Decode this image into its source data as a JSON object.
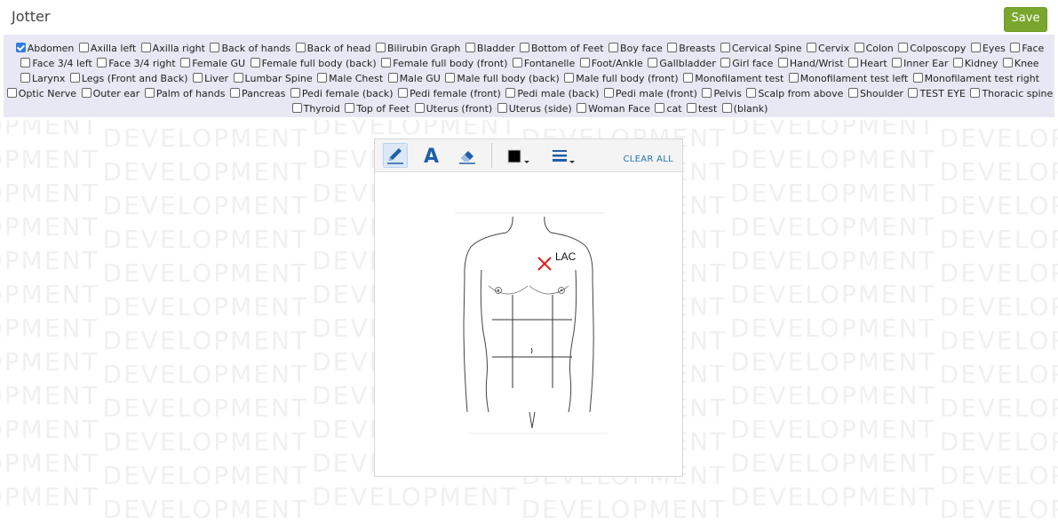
{
  "app": {
    "title": "Jotter"
  },
  "header": {
    "save_label": "Save"
  },
  "watermark": {
    "text": "DEVELOPMENT"
  },
  "filters": {
    "options": [
      {
        "label": "Abdomen",
        "checked": true
      },
      {
        "label": "Axilla left",
        "checked": false
      },
      {
        "label": "Axilla right",
        "checked": false
      },
      {
        "label": "Back of hands",
        "checked": false
      },
      {
        "label": "Back of head",
        "checked": false
      },
      {
        "label": "Bilirubin Graph",
        "checked": false
      },
      {
        "label": "Bladder",
        "checked": false
      },
      {
        "label": "Bottom of Feet",
        "checked": false
      },
      {
        "label": "Boy face",
        "checked": false
      },
      {
        "label": "Breasts",
        "checked": false
      },
      {
        "label": "Cervical Spine",
        "checked": false
      },
      {
        "label": "Cervix",
        "checked": false
      },
      {
        "label": "Colon",
        "checked": false
      },
      {
        "label": "Colposcopy",
        "checked": false
      },
      {
        "label": "Eyes",
        "checked": false
      },
      {
        "label": "Face",
        "checked": false
      },
      {
        "label": "Face 3/4 left",
        "checked": false
      },
      {
        "label": "Face 3/4 right",
        "checked": false
      },
      {
        "label": "Female GU",
        "checked": false
      },
      {
        "label": "Female full body (back)",
        "checked": false
      },
      {
        "label": "Female full body (front)",
        "checked": false
      },
      {
        "label": "Fontanelle",
        "checked": false
      },
      {
        "label": "Foot/Ankle",
        "checked": false
      },
      {
        "label": "Gallbladder",
        "checked": false
      },
      {
        "label": "Girl face",
        "checked": false
      },
      {
        "label": "Hand/Wrist",
        "checked": false
      },
      {
        "label": "Heart",
        "checked": false
      },
      {
        "label": "Inner Ear",
        "checked": false
      },
      {
        "label": "Kidney",
        "checked": false
      },
      {
        "label": "Knee",
        "checked": false
      },
      {
        "label": "Larynx",
        "checked": false
      },
      {
        "label": "Legs (Front and Back)",
        "checked": false
      },
      {
        "label": "Liver",
        "checked": false
      },
      {
        "label": "Lumbar Spine",
        "checked": false
      },
      {
        "label": "Male Chest",
        "checked": false
      },
      {
        "label": "Male GU",
        "checked": false
      },
      {
        "label": "Male full body (back)",
        "checked": false
      },
      {
        "label": "Male full body (front)",
        "checked": false
      },
      {
        "label": "Monofilament test",
        "checked": false
      },
      {
        "label": "Monofilament test left",
        "checked": false
      },
      {
        "label": "Monofilament test right",
        "checked": false
      },
      {
        "label": "Optic Nerve",
        "checked": false
      },
      {
        "label": "Outer ear",
        "checked": false
      },
      {
        "label": "Palm of hands",
        "checked": false
      },
      {
        "label": "Pancreas",
        "checked": false
      },
      {
        "label": "Pedi female (back)",
        "checked": false
      },
      {
        "label": "Pedi female (front)",
        "checked": false
      },
      {
        "label": "Pedi male (back)",
        "checked": false
      },
      {
        "label": "Pedi male (front)",
        "checked": false
      },
      {
        "label": "Pelvis",
        "checked": false
      },
      {
        "label": "Scalp from above",
        "checked": false
      },
      {
        "label": "Shoulder",
        "checked": false
      },
      {
        "label": "TEST EYE",
        "checked": false
      },
      {
        "label": "Thoracic spine",
        "checked": false
      },
      {
        "label": "Thyroid",
        "checked": false
      },
      {
        "label": "Top of Feet",
        "checked": false
      },
      {
        "label": "Uterus (front)",
        "checked": false
      },
      {
        "label": "Uterus (side)",
        "checked": false
      },
      {
        "label": "Woman Face",
        "checked": false
      },
      {
        "label": "cat",
        "checked": false
      },
      {
        "label": "test",
        "checked": false
      },
      {
        "label": "(blank)",
        "checked": false
      }
    ]
  },
  "toolbar": {
    "tools": [
      {
        "name": "pencil-tool",
        "icon": "pencil-icon",
        "active": true
      },
      {
        "name": "text-tool",
        "icon": "text-a-icon",
        "active": false
      },
      {
        "name": "eraser-tool",
        "icon": "eraser-icon",
        "active": false
      }
    ],
    "color_picker": {
      "icon": "color-swatch-icon",
      "selected_color": "#000000"
    },
    "line_width_picker": {
      "icon": "line-width-icon"
    },
    "clear_label": "CLEAR ALL",
    "accent_color": "#1f77b4"
  },
  "canvas": {
    "image": "male-torso-abdomen-diagram",
    "annotations": [
      {
        "type": "x-mark",
        "color": "#e02020",
        "label": "LAC"
      }
    ]
  }
}
